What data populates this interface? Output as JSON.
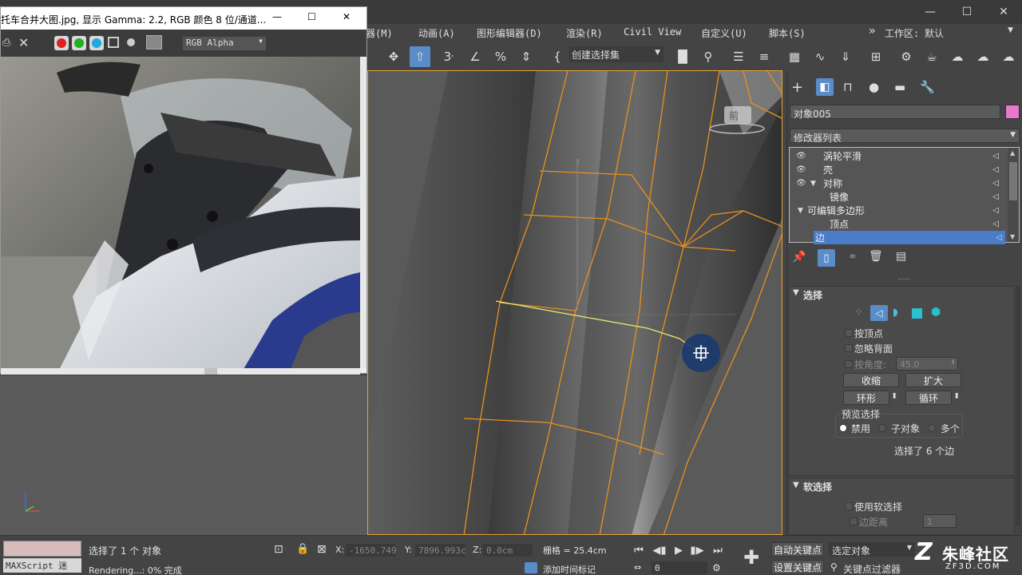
{
  "window": {
    "minimize": "—",
    "maximize": "☐",
    "close": "✕"
  },
  "menus": [
    "器(M)",
    "动画(A)",
    "图形编辑器(D)",
    "渲染(R)",
    "Civil View",
    "自定义(U)",
    "脚本(S)"
  ],
  "menu_overflow": "»",
  "workspace": {
    "label": "工作区:",
    "value": "默认"
  },
  "toolbar": {
    "selection_set": "创建选择集"
  },
  "image_window": {
    "title": "托车合并大图.jpg, 显示 Gamma: 2.2, RGB 颜色 8 位/通道...",
    "channel": "RGB Alpha",
    "colors": {
      "red": "#e02020",
      "green": "#20b020",
      "blue": "#20a8e0"
    }
  },
  "viewport": {
    "view_cube_label": "前",
    "axis_label": "y"
  },
  "command_panel": {
    "object_name": "对象005",
    "object_color": "#e878c8",
    "modifier_list": "修改器列表",
    "stack": [
      {
        "label": "涡轮平滑",
        "eye": true,
        "expand": "",
        "indent": 0
      },
      {
        "label": "壳",
        "eye": true,
        "expand": "",
        "indent": 0
      },
      {
        "label": "对称",
        "eye": true,
        "expand": "▼",
        "indent": 0
      },
      {
        "label": "镜像",
        "eye": false,
        "expand": "",
        "indent": 1
      },
      {
        "label": "可编辑多边形",
        "eye": false,
        "expand": "▼",
        "indent": 0
      },
      {
        "label": "顶点",
        "eye": false,
        "expand": "",
        "indent": 1
      },
      {
        "label": "边",
        "eye": false,
        "expand": "",
        "indent": 1,
        "selected": true
      }
    ],
    "selection": {
      "title": "选择",
      "by_vertex": "按顶点",
      "ignore_backfacing": "忽略背面",
      "by_angle": "按角度:",
      "angle_value": "45.0",
      "shrink": "收缩",
      "grow": "扩大",
      "ring": "环形",
      "loop": "循环",
      "preview_title": "预览选择",
      "preview_disabled": "禁用",
      "preview_subobject": "子对象",
      "preview_multi": "多个",
      "status": "选择了 6 个边"
    },
    "soft_selection": {
      "title": "软选择",
      "use_soft": "使用软选择",
      "edge_distance": "边距离",
      "edge_distance_value": "1"
    }
  },
  "statusbar": {
    "maxscript": "MAXScript 迷",
    "selected": "选择了 1 个 对象",
    "rendering": "Rendering...: 0% 完成",
    "x_label": "X:",
    "x_value": "-1650.749",
    "y_label": "Y:",
    "y_value": "7896.993c",
    "z_label": "Z:",
    "z_value": "0.0cm",
    "grid": "栅格 = 25.4cm",
    "add_time_tag": "添加时间标记",
    "frame": "0",
    "auto_key": "自动关键点",
    "set_key": "设置关键点",
    "selected_object": "选定对象",
    "key_filters": "关键点过滤器",
    "watermark": "朱峰社区",
    "watermark_url": "ZF3D.COM"
  }
}
